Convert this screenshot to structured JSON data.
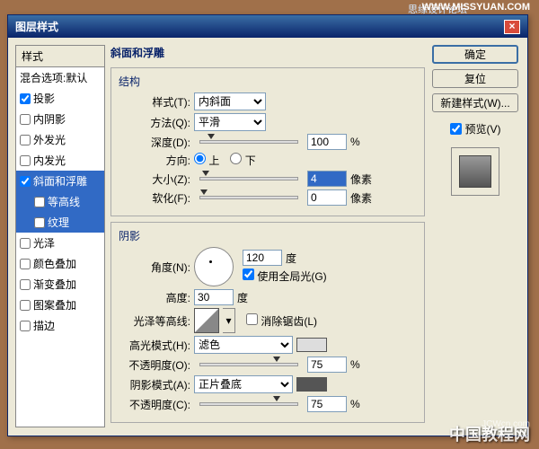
{
  "header": {
    "site": "思缘设计论坛",
    "url": "WWW.MISSYUAN.COM"
  },
  "dialog": {
    "title": "图层样式"
  },
  "sidebar": {
    "header": "样式",
    "blend": "混合选项:默认",
    "items": [
      {
        "label": "投影",
        "checked": true
      },
      {
        "label": "内阴影",
        "checked": false
      },
      {
        "label": "外发光",
        "checked": false
      },
      {
        "label": "内发光",
        "checked": false
      },
      {
        "label": "斜面和浮雕",
        "checked": true,
        "selected": true
      },
      {
        "label": "等高线",
        "checked": false,
        "sub": true,
        "selected": true
      },
      {
        "label": "纹理",
        "checked": false,
        "sub": true,
        "selected": true
      },
      {
        "label": "光泽",
        "checked": false
      },
      {
        "label": "颜色叠加",
        "checked": false
      },
      {
        "label": "渐变叠加",
        "checked": false
      },
      {
        "label": "图案叠加",
        "checked": false
      },
      {
        "label": "描边",
        "checked": false
      }
    ]
  },
  "main": {
    "title": "斜面和浮雕",
    "structure": {
      "legend": "结构",
      "style_label": "样式(T):",
      "style_value": "内斜面",
      "method_label": "方法(Q):",
      "method_value": "平滑",
      "depth_label": "深度(D):",
      "depth_value": "100",
      "depth_unit": "%",
      "direction_label": "方向:",
      "up": "上",
      "down": "下",
      "size_label": "大小(Z):",
      "size_value": "4",
      "size_unit": "像素",
      "soften_label": "软化(F):",
      "soften_value": "0",
      "soften_unit": "像素"
    },
    "shading": {
      "legend": "阴影",
      "angle_label": "角度(N):",
      "angle_value": "120",
      "angle_unit": "度",
      "global_label": "使用全局光(G)",
      "altitude_label": "高度:",
      "altitude_value": "30",
      "altitude_unit": "度",
      "gloss_label": "光泽等高线:",
      "antialias_label": "消除锯齿(L)",
      "highlight_mode_label": "高光模式(H):",
      "highlight_mode_value": "滤色",
      "opacity1_label": "不透明度(O):",
      "opacity1_value": "75",
      "opacity1_unit": "%",
      "shadow_mode_label": "阴影模式(A):",
      "shadow_mode_value": "正片叠底",
      "opacity2_label": "不透明度(C):",
      "opacity2_value": "75",
      "opacity2_unit": "%"
    }
  },
  "buttons": {
    "ok": "确定",
    "cancel": "复位",
    "newstyle": "新建样式(W)...",
    "preview": "预览(V)"
  },
  "watermark": {
    "big": "中国教程网",
    "small": "JCWcn.com"
  }
}
